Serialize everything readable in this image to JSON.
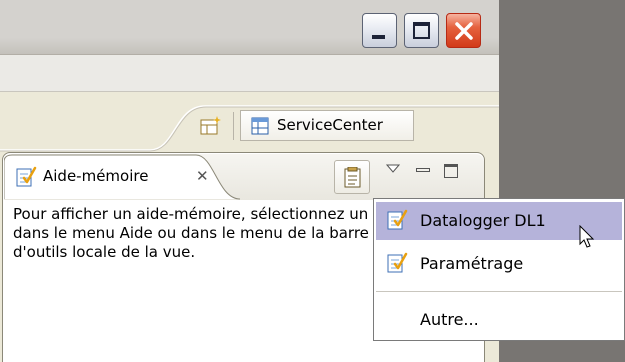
{
  "perspective": {
    "open_perspective_icon": "open-perspective-icon",
    "active_label": "ServiceCenter",
    "active_icon": "perspective-table-icon"
  },
  "view": {
    "tab_title": "Aide-mémoire",
    "tab_close_glyph": "✕",
    "content_text": "Pour afficher un aide-mémoire, sélectionnez un élément\ndans le menu Aide ou dans le menu de la barre\nd'outils locale de la vue."
  },
  "dropdown_menu": {
    "items": [
      {
        "label": "Datalogger DL1",
        "icon": "cheatsheet-icon",
        "selected": true
      },
      {
        "label": "Paramétrage",
        "icon": "cheatsheet-icon",
        "selected": false
      },
      {
        "label": "Autre...",
        "icon": "",
        "selected": false
      }
    ]
  },
  "colors": {
    "menu_highlight": "#b5b3da",
    "close_button": "#d23a18"
  }
}
